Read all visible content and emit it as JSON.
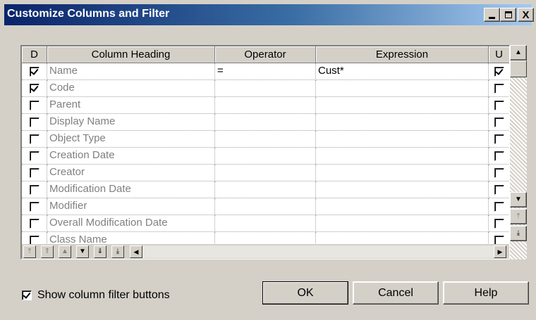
{
  "window": {
    "title": "Customize Columns and Filter",
    "controls": {
      "minimize": "_",
      "maximize": "□",
      "close": "X"
    }
  },
  "grid": {
    "headers": {
      "d": "D",
      "column_heading": "Column Heading",
      "operator": "Operator",
      "expression": "Expression",
      "u": "U"
    },
    "rows": [
      {
        "d": true,
        "name": "Name",
        "operator": "=",
        "expression": "Cust*",
        "u": true
      },
      {
        "d": true,
        "name": "Code",
        "operator": "",
        "expression": "",
        "u": false
      },
      {
        "d": false,
        "name": "Parent",
        "operator": "",
        "expression": "",
        "u": false
      },
      {
        "d": false,
        "name": "Display Name",
        "operator": "",
        "expression": "",
        "u": false
      },
      {
        "d": false,
        "name": "Object Type",
        "operator": "",
        "expression": "",
        "u": false
      },
      {
        "d": false,
        "name": "Creation Date",
        "operator": "",
        "expression": "",
        "u": false
      },
      {
        "d": false,
        "name": "Creator",
        "operator": "",
        "expression": "",
        "u": false
      },
      {
        "d": false,
        "name": "Modification Date",
        "operator": "",
        "expression": "",
        "u": false
      },
      {
        "d": false,
        "name": "Modifier",
        "operator": "",
        "expression": "",
        "u": false
      },
      {
        "d": false,
        "name": "Overall Modification Date",
        "operator": "",
        "expression": "",
        "u": false
      },
      {
        "d": false,
        "name": "Class Name",
        "operator": "",
        "expression": "",
        "u": false
      }
    ],
    "nav_buttons": [
      {
        "icon": "move-to-top-icon",
        "glyph": "⤒",
        "enabled": false
      },
      {
        "icon": "move-up-fast-icon",
        "glyph": "⇑",
        "enabled": false
      },
      {
        "icon": "move-up-icon",
        "glyph": "▲",
        "enabled": false
      },
      {
        "icon": "move-down-icon",
        "glyph": "▼",
        "enabled": true
      },
      {
        "icon": "move-down-fast-icon",
        "glyph": "⇓",
        "enabled": true
      },
      {
        "icon": "move-to-bottom-icon",
        "glyph": "⤓",
        "enabled": true
      }
    ]
  },
  "footer": {
    "show_filter_buttons_label": "Show column filter buttons",
    "show_filter_buttons_checked": true,
    "ok_label": "OK",
    "cancel_label": "Cancel",
    "help_label": "Help"
  },
  "colors": {
    "title_gradient_start": "#0a246a",
    "title_gradient_end": "#a6caf0",
    "dialog_face": "#d4d0c8",
    "disabled_text": "#808080"
  }
}
